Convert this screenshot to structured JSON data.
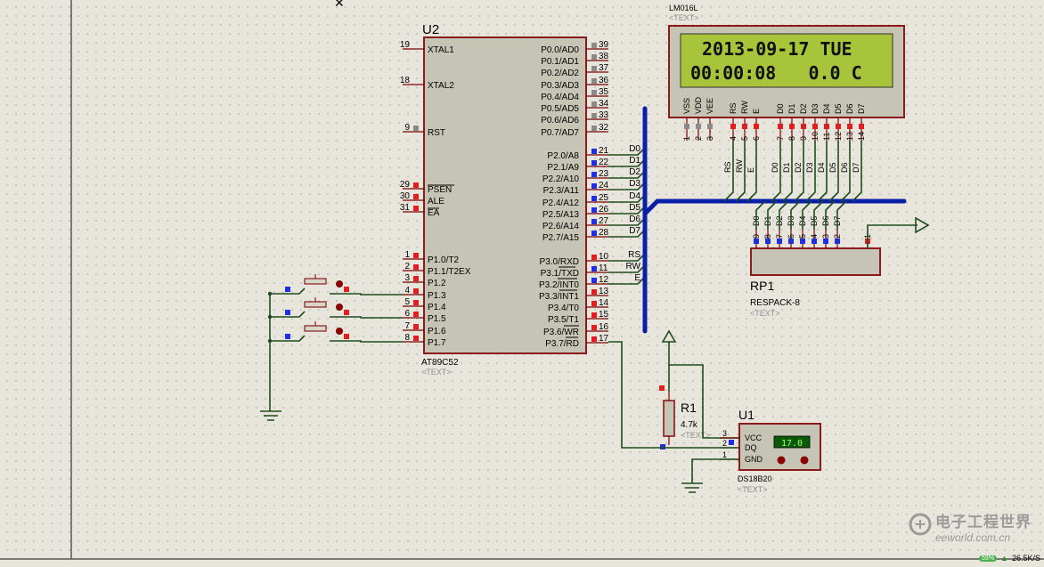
{
  "u2": {
    "ref": "U2",
    "part": "AT89C52",
    "text": "<TEXT>",
    "left_pins": [
      {
        "num": "19",
        "name": "XTAL1"
      },
      {
        "num": "18",
        "name": "XTAL2"
      },
      {
        "num": "9",
        "name": "RST"
      },
      {
        "num": "29",
        "name": "PSEN"
      },
      {
        "num": "30",
        "name": "ALE"
      },
      {
        "num": "31",
        "name": "EA"
      },
      {
        "num": "1",
        "name": "P1.0/T2"
      },
      {
        "num": "2",
        "name": "P1.1/T2EX"
      },
      {
        "num": "3",
        "name": "P1.2"
      },
      {
        "num": "4",
        "name": "P1.3"
      },
      {
        "num": "5",
        "name": "P1.4"
      },
      {
        "num": "6",
        "name": "P1.5"
      },
      {
        "num": "7",
        "name": "P1.6"
      },
      {
        "num": "8",
        "name": "P1.7"
      }
    ],
    "right_pins": [
      {
        "num": "39",
        "name": "P0.0/AD0"
      },
      {
        "num": "38",
        "name": "P0.1/AD1"
      },
      {
        "num": "37",
        "name": "P0.2/AD2"
      },
      {
        "num": "36",
        "name": "P0.3/AD3"
      },
      {
        "num": "35",
        "name": "P0.4/AD4"
      },
      {
        "num": "34",
        "name": "P0.5/AD5"
      },
      {
        "num": "33",
        "name": "P0.6/AD6"
      },
      {
        "num": "32",
        "name": "P0.7/AD7"
      },
      {
        "num": "21",
        "name": "P2.0/A8",
        "net": "D0"
      },
      {
        "num": "22",
        "name": "P2.1/A9",
        "net": "D1"
      },
      {
        "num": "23",
        "name": "P2.2/A10",
        "net": "D2"
      },
      {
        "num": "24",
        "name": "P2.3/A11",
        "net": "D3"
      },
      {
        "num": "25",
        "name": "P2.4/A12",
        "net": "D4"
      },
      {
        "num": "26",
        "name": "P2.5/A13",
        "net": "D5"
      },
      {
        "num": "27",
        "name": "P2.6/A14",
        "net": "D6"
      },
      {
        "num": "28",
        "name": "P2.7/A15",
        "net": "D7"
      },
      {
        "num": "10",
        "name": "P3.0/RXD",
        "net": "RS"
      },
      {
        "num": "11",
        "name": "P3.1/TXD",
        "net": "RW"
      },
      {
        "num": "12",
        "name": "P3.2/INT0",
        "net": "E"
      },
      {
        "num": "13",
        "name": "P3.3/INT1"
      },
      {
        "num": "14",
        "name": "P3.4/T0"
      },
      {
        "num": "15",
        "name": "P3.5/T1"
      },
      {
        "num": "16",
        "name": "P3.6/WR"
      },
      {
        "num": "17",
        "name": "P3.7/RD"
      }
    ]
  },
  "lcd": {
    "ref": "LM016L",
    "text": "<TEXT>",
    "line1": "2013-09-17 TUE",
    "line2": "00:00:08   0.0 C",
    "lcd_bg": "#a8c43a",
    "pins": [
      {
        "name": "VSS",
        "num": "1"
      },
      {
        "name": "VDD",
        "num": "2"
      },
      {
        "name": "VEE",
        "num": "3"
      },
      {
        "name": "RS",
        "num": "4"
      },
      {
        "name": "RW",
        "num": "5"
      },
      {
        "name": "E",
        "num": "6"
      },
      {
        "name": "D0",
        "num": "7"
      },
      {
        "name": "D1",
        "num": "8"
      },
      {
        "name": "D2",
        "num": "9"
      },
      {
        "name": "D3",
        "num": "10"
      },
      {
        "name": "D4",
        "num": "11"
      },
      {
        "name": "D5",
        "num": "12"
      },
      {
        "name": "D6",
        "num": "13"
      },
      {
        "name": "D7",
        "num": "14"
      }
    ],
    "net_labels": [
      "RS",
      "RW",
      "E",
      "D0",
      "D1",
      "D2",
      "D3",
      "D4",
      "D5",
      "D6",
      "D7"
    ]
  },
  "rp1": {
    "ref": "RP1",
    "part": "RESPACK-8",
    "text": "<TEXT>",
    "pins": [
      {
        "num": "9",
        "net": "D0"
      },
      {
        "num": "8",
        "net": "D1"
      },
      {
        "num": "7",
        "net": "D2"
      },
      {
        "num": "6",
        "net": "D3"
      },
      {
        "num": "5",
        "net": "D4"
      },
      {
        "num": "4",
        "net": "D5"
      },
      {
        "num": "3",
        "net": "D6"
      },
      {
        "num": "2",
        "net": "D7"
      },
      {
        "num": "1",
        "net": ""
      }
    ]
  },
  "r1": {
    "ref": "R1",
    "value": "4.7k",
    "text": "<TEXT>"
  },
  "u1": {
    "ref": "U1",
    "part": "DS18B20",
    "text": "<TEXT>",
    "reading": "17.0",
    "pins": [
      {
        "num": "3",
        "name": "VCC"
      },
      {
        "num": "2",
        "name": "DQ"
      },
      {
        "num": "1",
        "name": "GND"
      }
    ]
  },
  "watermark": {
    "cn": "电子工程世界",
    "en": "eeworld.com.cn"
  },
  "status": {
    "speed": "26.5K/S",
    "badge": "59%"
  },
  "colors": {
    "wire": "#1d4d1d",
    "bus": "#0a1fa8",
    "outline": "#8b1a1a",
    "body": "#c6c5b5",
    "pin_red": "#e02020",
    "pin_blue": "#2030e0",
    "pin_gray": "#8a8a8a"
  }
}
